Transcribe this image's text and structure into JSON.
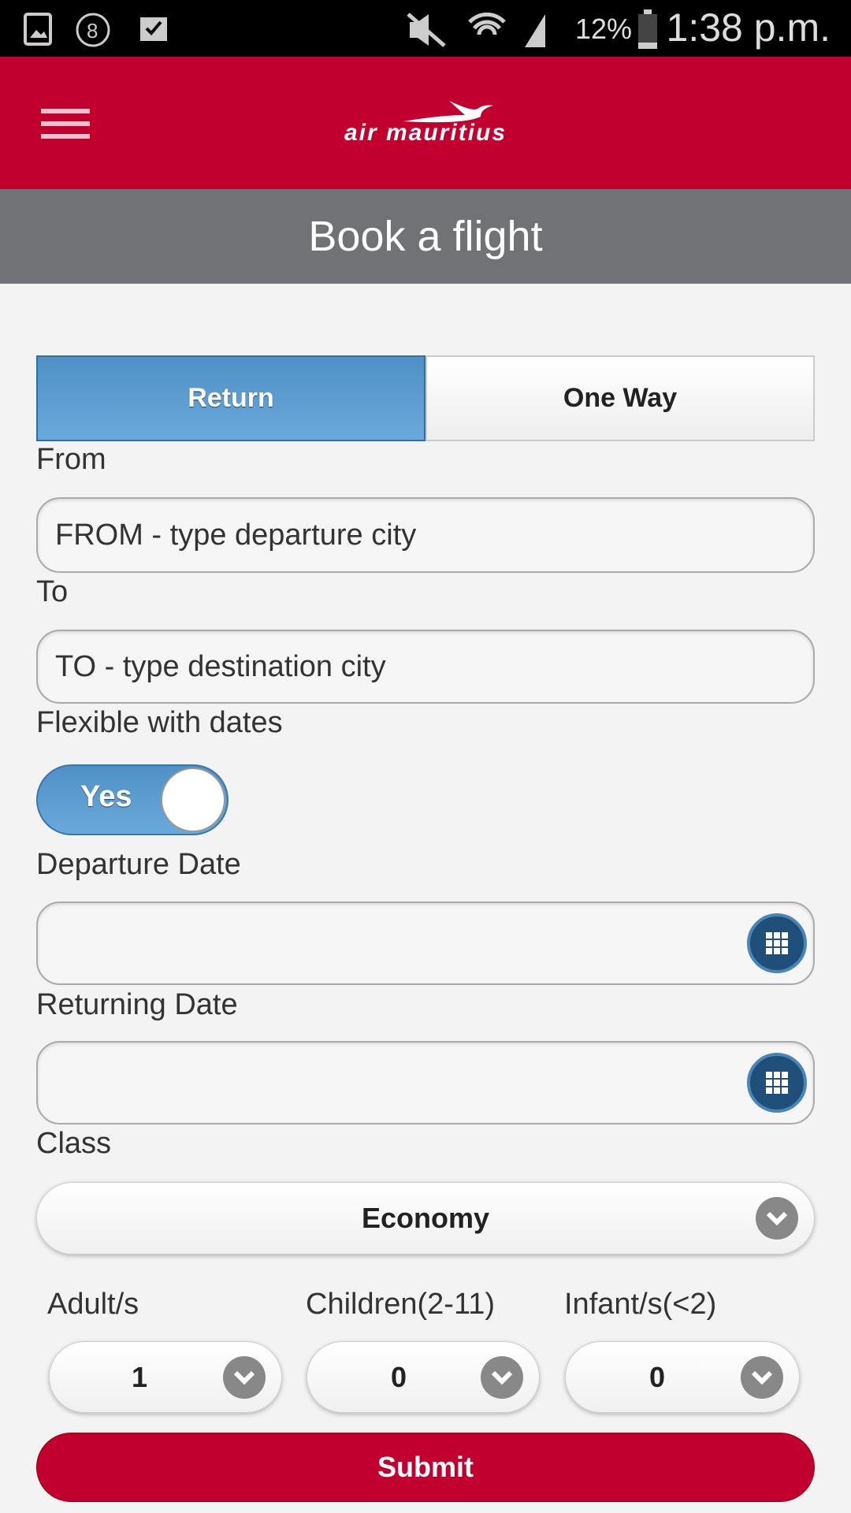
{
  "status_bar": {
    "battery": "12%",
    "time": "1:38 p.m.",
    "icons": [
      "gallery-icon",
      "notification-8-icon",
      "clipboard-check-icon",
      "mute-icon",
      "wifi-icon",
      "signal-icon",
      "battery-icon"
    ]
  },
  "header": {
    "logo_text": "air mauritius",
    "menu_icon": "hamburger-icon",
    "brand_color": "#c20030"
  },
  "title": "Book a flight",
  "trip_tabs": [
    {
      "label": "Return",
      "active": true
    },
    {
      "label": "One Way",
      "active": false
    }
  ],
  "from": {
    "label": "From",
    "placeholder": "FROM - type departure city"
  },
  "to": {
    "label": "To",
    "placeholder": "TO - type destination city"
  },
  "flexible": {
    "label": "Flexible with dates",
    "value": "Yes"
  },
  "departure_date": {
    "label": "Departure Date",
    "value": ""
  },
  "returning_date": {
    "label": "Returning Date",
    "value": ""
  },
  "class": {
    "label": "Class",
    "value": "Economy"
  },
  "passengers": [
    {
      "label": "Adult/s",
      "value": "1"
    },
    {
      "label": "Children(2-11)",
      "value": "0"
    },
    {
      "label": "Infant/s(<2)",
      "value": "0"
    }
  ],
  "submit_label": "Submit",
  "accent_color": "#4f90c6"
}
